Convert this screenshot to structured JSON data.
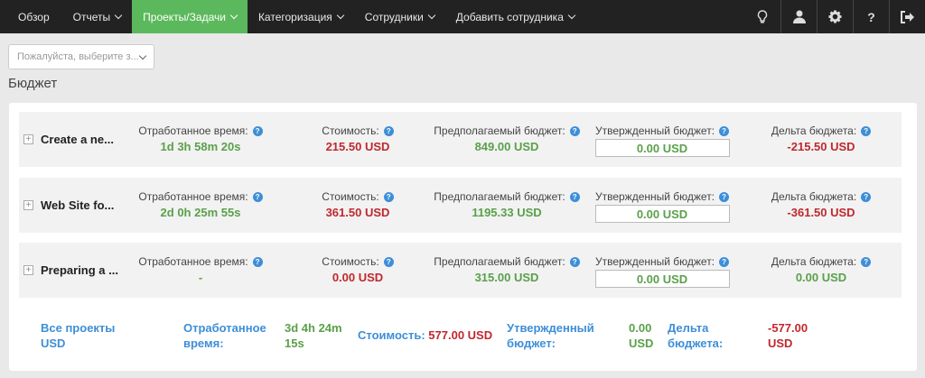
{
  "navbar": {
    "items": [
      {
        "label": "Обзор",
        "caret": false
      },
      {
        "label": "Отчеты",
        "caret": true
      },
      {
        "label": "Проекты/Задачи",
        "caret": true,
        "active": true
      },
      {
        "label": "Категоризация",
        "caret": true
      },
      {
        "label": "Сотрудники",
        "caret": true
      },
      {
        "label": "Добавить сотрудника",
        "caret": true
      }
    ],
    "help_glyph": "?"
  },
  "filter": {
    "placeholder": "Пожалуйста, выберите з..."
  },
  "page_title": "Бюджет",
  "labels": {
    "worked_time": "Отработанное время:",
    "cost": "Стоимость:",
    "planned_budget": "Предполагаемый бюджет:",
    "approved_budget": "Утвержденный бюджет:",
    "budget_delta": "Дельта бюджета:",
    "info": "?",
    "expand": "+"
  },
  "projects": [
    {
      "name": "Create a ne...",
      "worked_time": "1d 3h 58m 20s",
      "cost": "215.50 USD",
      "planned_budget": "849.00 USD",
      "approved_budget": "0.00 USD",
      "budget_delta": "-215.50 USD"
    },
    {
      "name": "Web Site fo...",
      "worked_time": "2d 0h 25m 55s",
      "cost": "361.50 USD",
      "planned_budget": "1195.33 USD",
      "approved_budget": "0.00 USD",
      "budget_delta": "-361.50 USD"
    },
    {
      "name": "Preparing a ...",
      "worked_time": "-",
      "cost": "0.00 USD",
      "planned_budget": "315.00 USD",
      "approved_budget": "0.00 USD",
      "budget_delta": "0.00 USD"
    }
  ],
  "summary": {
    "all_projects_l1": "Все проекты",
    "all_projects_l2": "USD",
    "worked_time_l1": "Отработанное",
    "worked_time_l2": "время:",
    "worked_time_v1": "3d 4h 24m",
    "worked_time_v2": "15s",
    "cost_label": "Стоимость:",
    "cost_value": "577.00 USD",
    "approved_l1": "Утвержденный",
    "approved_l2": "бюджет:",
    "approved_v1": "0.00",
    "approved_v2": "USD",
    "delta_l1": "Дельта",
    "delta_l2": "бюджета:",
    "delta_v1": "-577.00",
    "delta_v2": "USD"
  },
  "colors": {
    "nav_bg": "#222222",
    "nav_active": "#5cb85c",
    "positive": "#5aa04a",
    "negative": "#c0282d",
    "accent": "#3d8ed8"
  }
}
